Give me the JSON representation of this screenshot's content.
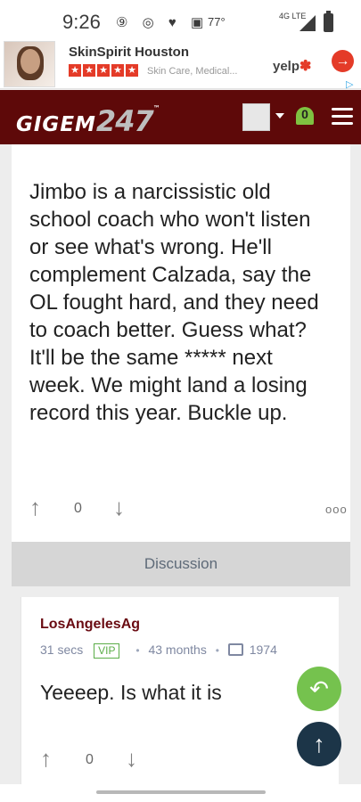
{
  "status": {
    "time": "9:26",
    "temp": "77°",
    "network": "4G LTE"
  },
  "ad": {
    "name": "SkinSpirit Houston",
    "description": "Skin Care, Medical...",
    "rating_stars": 5,
    "brand": "yelp"
  },
  "header": {
    "logo_main": "GIGEM",
    "logo_num": "247",
    "trademark": "™",
    "notification_count": "0"
  },
  "post": {
    "text": "Jimbo is a narcissistic old school coach who won't listen or see what's wrong. He'll complement Calzada, say the OL fought hard, and they need to coach better. Guess what? It'll be the same ***** next week. We might land a losing record this year. Buckle up.",
    "votes": "0",
    "more": "ooo"
  },
  "discussion": {
    "label": "Discussion"
  },
  "comment": {
    "username": "LosAngelesAg",
    "time": "31 secs",
    "badge": "VIP",
    "tenure": "43 months",
    "posts": "1974",
    "text": "Yeeeep. Is what it is",
    "votes": "0"
  },
  "icons": {
    "reply": "reply-icon",
    "scroll_top": "arrow-up-icon",
    "menu": "hamburger-menu-icon",
    "bell": "bell-icon"
  },
  "colors": {
    "brand_maroon": "#5e0909",
    "reply_green": "#75c24e",
    "scroll_navy": "#1c3548",
    "vip_green": "#5bad48"
  }
}
